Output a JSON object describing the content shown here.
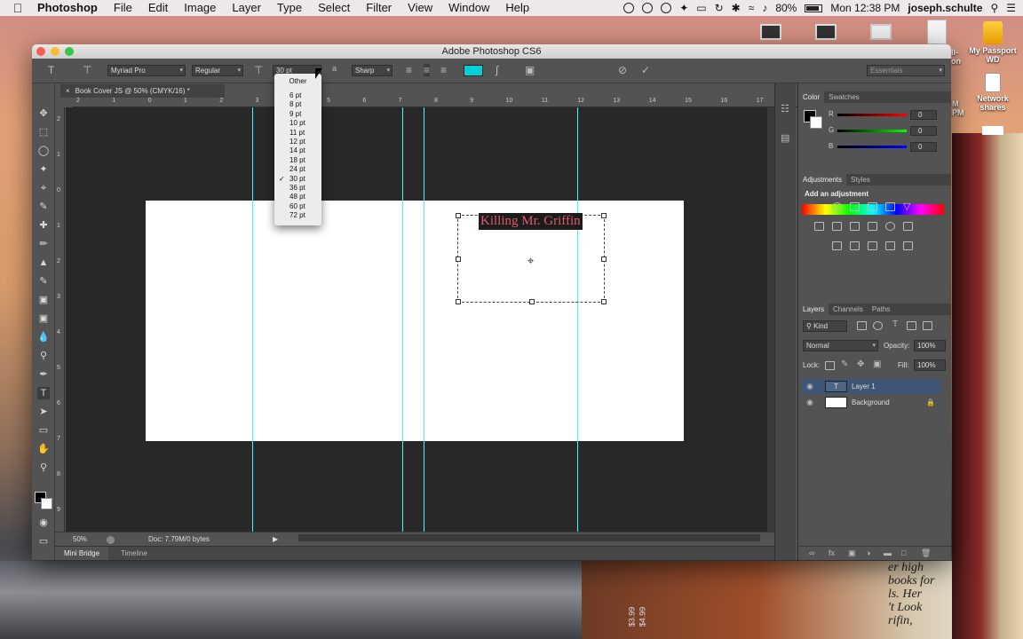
{
  "menubar": {
    "app": "Photoshop",
    "items": [
      "File",
      "Edit",
      "Image",
      "Layer",
      "Type",
      "Select",
      "Filter",
      "View",
      "Window",
      "Help"
    ],
    "battery": "80%",
    "clock": "Mon 12:38 PM",
    "user": "joseph.schulte"
  },
  "desktop": {
    "icon1_label": "My Passport WD",
    "icon2_label": "Network shares",
    "left_fragment_1": "ll-",
    "left_fragment_2": "on",
    "left_fragment_3": "M",
    "left_fragment_4": "PM",
    "book_lines": [
      "er high",
      "books for",
      "ls. Her",
      "'t Look",
      "rifin,"
    ],
    "price_1": "$3.99",
    "price_2": "$4.99"
  },
  "window": {
    "title": "Adobe Photoshop CS6",
    "workspace": "Essentials"
  },
  "options": {
    "font_family": "Myriad Pro",
    "font_style": "Regular",
    "font_size": "30 pt",
    "antialias": "Sharp",
    "text_color": "#00d0d8"
  },
  "document": {
    "tab_title": "Book Cover JS @ 50% (CMYK/16) *",
    "zoom": "50%",
    "doc_info": "Doc: 7.79M/0 bytes",
    "text_content": "Killing Mr. Griffin",
    "text_color": "#e05a6a"
  },
  "ruler_h": [
    "2",
    "1",
    "0",
    "1",
    "2",
    "3",
    "4",
    "5",
    "6",
    "7",
    "8",
    "9",
    "10",
    "11",
    "12",
    "13",
    "14",
    "15",
    "16",
    "17"
  ],
  "ruler_v": [
    "2",
    "1",
    "0",
    "1",
    "2",
    "3",
    "4",
    "5",
    "6",
    "7",
    "8",
    "9"
  ],
  "dropdown": {
    "other": "Other",
    "sizes": [
      "6 pt",
      "8 pt",
      "9 pt",
      "10 pt",
      "11 pt",
      "12 pt",
      "14 pt",
      "18 pt",
      "24 pt",
      "30 pt",
      "36 pt",
      "48 pt",
      "60 pt",
      "72 pt"
    ],
    "selected": "30 pt"
  },
  "bottom_tabs": [
    "Mini Bridge",
    "Timeline"
  ],
  "color_panel": {
    "tabs": [
      "Color",
      "Swatches"
    ],
    "r_label": "R",
    "g_label": "G",
    "b_label": "B",
    "r": "0",
    "g": "0",
    "b": "0"
  },
  "adjustments": {
    "tabs": [
      "Adjustments",
      "Styles"
    ],
    "heading": "Add an adjustment"
  },
  "layers": {
    "tabs": [
      "Layers",
      "Channels",
      "Paths"
    ],
    "kind_label": "Kind",
    "blend_mode": "Normal",
    "opacity_label": "Opacity:",
    "opacity": "100%",
    "lock_label": "Lock:",
    "fill_label": "Fill:",
    "fill": "100%",
    "items": [
      {
        "name": "Layer 1",
        "selected": true
      },
      {
        "name": "Background",
        "selected": false
      }
    ]
  }
}
